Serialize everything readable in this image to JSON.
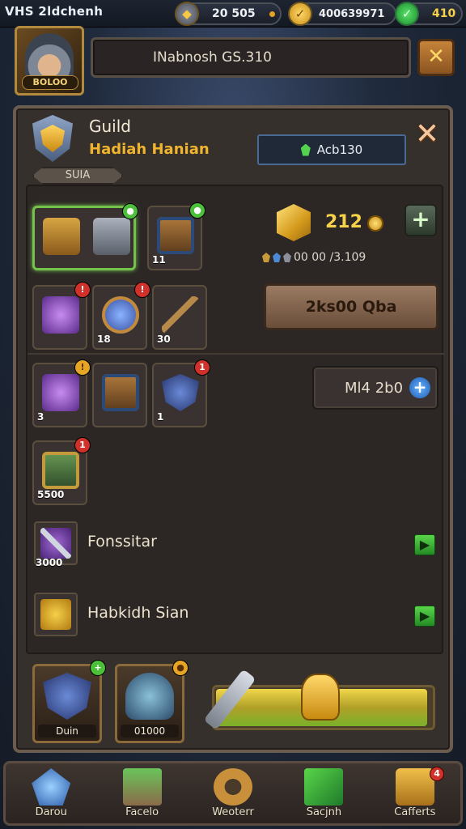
{
  "top_bar": {
    "title": "VHS 2ldchenh",
    "resources": [
      {
        "icon": "stone-icon",
        "value": "20 505"
      },
      {
        "icon": "gold-coin-icon",
        "value": "400639971"
      },
      {
        "icon": "gem-icon",
        "value": "410"
      }
    ]
  },
  "profile": {
    "level_label": "BOLOO",
    "name_bar_text": "INabnosh GS.310",
    "close_label": "✕"
  },
  "guild": {
    "title": "Guild",
    "name": "Hadiah Hanian",
    "tag": "SUIA",
    "code": "Acb130",
    "close_label": "✕"
  },
  "inventory": {
    "gold_amount": "212",
    "add_label": "+",
    "stat_text": "00 00 /3.109",
    "action_button": "2ks00 Qba",
    "small_button": "Ml4 2b0",
    "small_button_plus": "+",
    "slots": [
      {
        "name": "slot-chest",
        "art": "chest",
        "qty": "",
        "badge": "●",
        "badge_color": "green",
        "selected": true
      },
      {
        "name": "slot-crate",
        "art": "crate",
        "qty": "11",
        "badge": "●",
        "badge_color": "green",
        "selected": false
      },
      {
        "name": "slot-purple-staff",
        "art": "purple",
        "qty": "",
        "badge": "!",
        "badge_color": "red",
        "selected": false
      },
      {
        "name": "slot-blue-orb",
        "art": "blue",
        "qty": "18",
        "badge": "!",
        "badge_color": "red",
        "selected": false
      },
      {
        "name": "slot-bow",
        "art": "bow",
        "qty": "30",
        "badge": "",
        "badge_color": "",
        "selected": false
      },
      {
        "name": "slot-purple-box",
        "art": "purple",
        "qty": "3",
        "badge": "!",
        "badge_color": "gold",
        "selected": false
      },
      {
        "name": "slot-treasure",
        "art": "crate",
        "qty": "",
        "badge": "",
        "badge_color": "",
        "selected": false
      },
      {
        "name": "slot-shield",
        "art": "shield",
        "qty": "1",
        "badge": "1",
        "badge_color": "red",
        "selected": false
      },
      {
        "name": "slot-map",
        "art": "map",
        "qty": "5500",
        "badge": "1",
        "badge_color": "red",
        "selected": false
      }
    ],
    "list": [
      {
        "label": "Fonssitar",
        "qty": "3000",
        "art": "sword"
      },
      {
        "label": "Habkidh Sian",
        "qty": "",
        "art": "weight"
      }
    ]
  },
  "heroes": [
    {
      "label": "Duin"
    },
    {
      "label": "01000"
    }
  ],
  "boost_progress": 0.98,
  "bottom_nav": [
    {
      "label": "Darou",
      "icon": "crystal-icon"
    },
    {
      "label": "Facelo",
      "icon": "book-icon"
    },
    {
      "label": "Weoterr",
      "icon": "helmet-icon"
    },
    {
      "label": "Sacjnh",
      "icon": "scroll-icon"
    },
    {
      "label": "Cafferts",
      "icon": "chest-icon",
      "badge": "4"
    }
  ]
}
